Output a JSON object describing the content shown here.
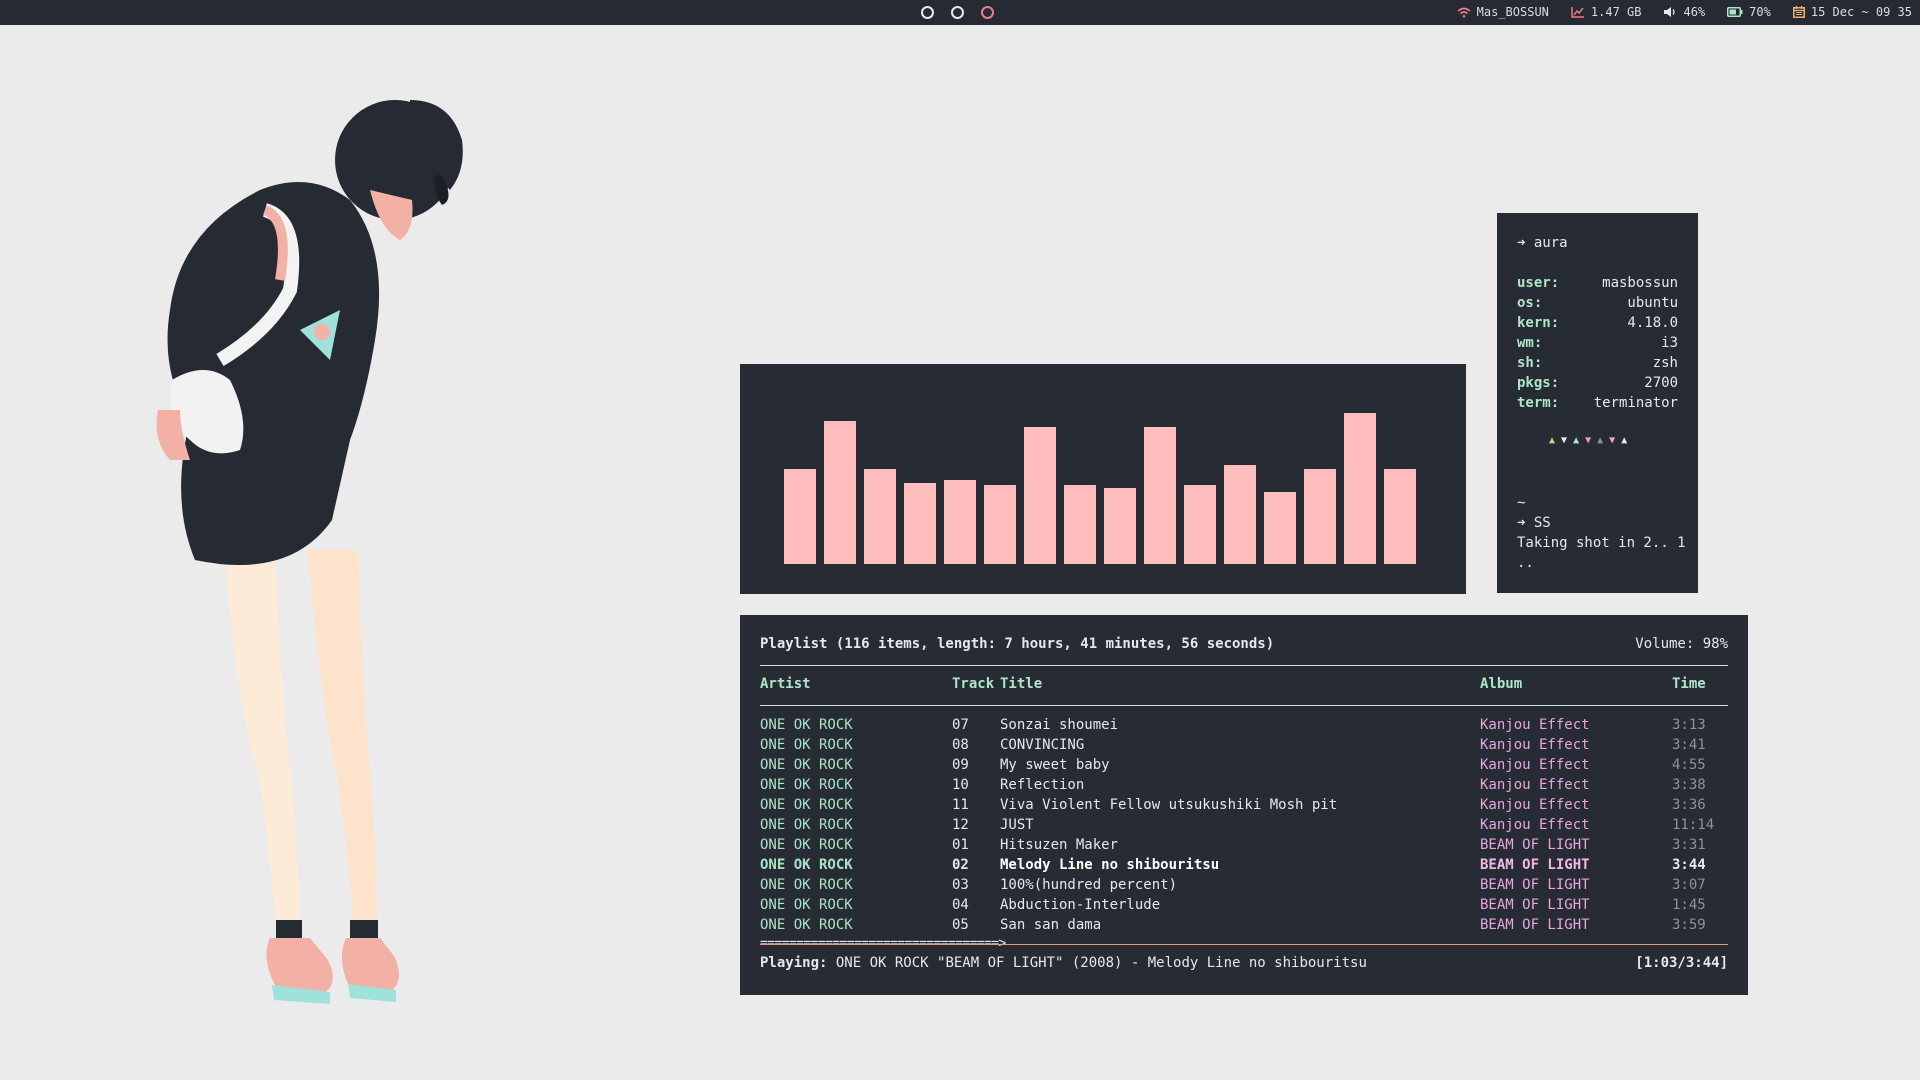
{
  "workspaces": [
    {
      "id": "1",
      "active": false
    },
    {
      "id": "2",
      "active": false
    },
    {
      "id": "3",
      "active": true
    }
  ],
  "status_bar": {
    "wifi": {
      "icon": "wifi-icon",
      "text": "Mas_BOSSUN"
    },
    "memory": {
      "icon": "chart-icon",
      "text": "1.47 GB"
    },
    "volume": {
      "icon": "speaker-icon",
      "text": "46%"
    },
    "battery": {
      "icon": "battery-icon",
      "text": "70%"
    },
    "datetime": {
      "icon": "calendar-icon",
      "text": "15 Dec ~ 09 35"
    }
  },
  "visualizer": {
    "bar_color": "#ffbdbd",
    "levels": [
      0.54,
      0.81,
      0.54,
      0.46,
      0.48,
      0.45,
      0.78,
      0.45,
      0.43,
      0.78,
      0.45,
      0.56,
      0.41,
      0.54,
      0.86,
      0.54
    ]
  },
  "fetch": {
    "prompt_arrow": "➜",
    "title": "aura",
    "rows": [
      {
        "key": "user:",
        "value": "masbossun"
      },
      {
        "key": "os:",
        "value": "ubuntu"
      },
      {
        "key": "kern:",
        "value": "4.18.0"
      },
      {
        "key": "wm:",
        "value": "i3"
      },
      {
        "key": "sh:",
        "value": "zsh"
      },
      {
        "key": "pkgs:",
        "value": "2700"
      },
      {
        "key": "term:",
        "value": "terminator"
      }
    ],
    "triangles": [
      {
        "glyph": "▲",
        "color": "#e8c27a"
      },
      {
        "glyph": "▼",
        "color": "#e6e8ec"
      },
      {
        "glyph": "▲",
        "color": "#aee6c9"
      },
      {
        "glyph": "▼",
        "color": "#f0a0a0"
      },
      {
        "glyph": "▲",
        "color": "#8d929c"
      },
      {
        "glyph": "▼",
        "color": "#e7a7de"
      },
      {
        "glyph": "▲",
        "color": "#e6e8ec"
      }
    ],
    "tilde": "~",
    "command": "SS",
    "output": "Taking shot in 2.. 1",
    "output2": ".."
  },
  "player": {
    "header": "Playlist (116 items, length: 7 hours, 41 minutes, 56 seconds)",
    "volume": "Volume: 98%",
    "columns": {
      "artist": "Artist",
      "track": "Track",
      "title": "Title",
      "album": "Album",
      "time": "Time"
    },
    "rows": [
      {
        "artist": "ONE OK ROCK",
        "track": "07",
        "title": "Sonzai shoumei",
        "album": "Kanjou Effect",
        "time": "3:13"
      },
      {
        "artist": "ONE OK ROCK",
        "track": "08",
        "title": "CONVINCING",
        "album": "Kanjou Effect",
        "time": "3:41"
      },
      {
        "artist": "ONE OK ROCK",
        "track": "09",
        "title": "My sweet baby",
        "album": "Kanjou Effect",
        "time": "4:55"
      },
      {
        "artist": "ONE OK ROCK",
        "track": "10",
        "title": "Reflection",
        "album": "Kanjou Effect",
        "time": "3:38"
      },
      {
        "artist": "ONE OK ROCK",
        "track": "11",
        "title": "Viva Violent Fellow utsukushiki Mosh pit",
        "album": "Kanjou Effect",
        "time": "3:36"
      },
      {
        "artist": "ONE OK ROCK",
        "track": "12",
        "title": "JUST",
        "album": "Kanjou Effect",
        "time": "11:14"
      },
      {
        "artist": "ONE OK ROCK",
        "track": "01",
        "title": "Hitsuzen Maker",
        "album": "BEAM OF LIGHT",
        "time": "3:31"
      },
      {
        "artist": "ONE OK ROCK",
        "track": "02",
        "title": "Melody Line no shibouritsu",
        "album": "BEAM OF LIGHT",
        "time": "3:44",
        "current": true
      },
      {
        "artist": "ONE OK ROCK",
        "track": "03",
        "title": "100%(hundred percent)",
        "album": "BEAM OF LIGHT",
        "time": "3:07"
      },
      {
        "artist": "ONE OK ROCK",
        "track": "04",
        "title": "Abduction-Interlude",
        "album": "BEAM OF LIGHT",
        "time": "1:45"
      },
      {
        "artist": "ONE OK ROCK",
        "track": "05",
        "title": "San san dama",
        "album": "BEAM OF LIGHT",
        "time": "3:59"
      }
    ],
    "progress_bar": "=================================>",
    "progress_fraction": 0.28,
    "now_playing_label": "Playing:",
    "now_playing": "ONE OK ROCK \"BEAM OF LIGHT\" (2008) - Melody Line no shibouritsu",
    "elapsed": "[1:03/3:44]"
  },
  "colors": {
    "panel_bg": "#272b34",
    "desktop_bg": "#ecebeb",
    "accent_green": "#aee6c9",
    "accent_pink": "#e7a7de",
    "active_workspace": "#f07a84"
  }
}
